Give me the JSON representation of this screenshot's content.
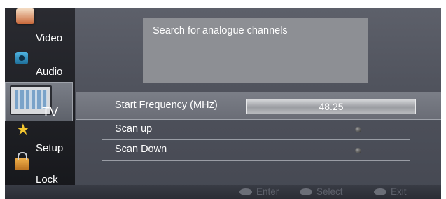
{
  "sidebar": {
    "items": [
      {
        "label": "Video",
        "icon": "video-icon"
      },
      {
        "label": "Audio",
        "icon": "audio-icon"
      },
      {
        "label": "TV",
        "icon": "tv-icon",
        "selected": true
      },
      {
        "label": "Setup",
        "icon": "star-icon"
      },
      {
        "label": "Lock",
        "icon": "lock-icon"
      }
    ]
  },
  "info": {
    "text": "Search for analogue channels"
  },
  "options": {
    "start_frequency_label": "Start Frequency (MHz)",
    "start_frequency_value": "48.25",
    "scan_up_label": "Scan up",
    "scan_down_label": "Scan Down"
  },
  "footer": {
    "enter_label": "Enter",
    "select_label": "Select",
    "exit_label": "Exit"
  },
  "colors": {
    "panel": "#52555f",
    "sidebar": "#1e1f24",
    "highlight": "#757881",
    "info_box": "#8d8f94"
  }
}
